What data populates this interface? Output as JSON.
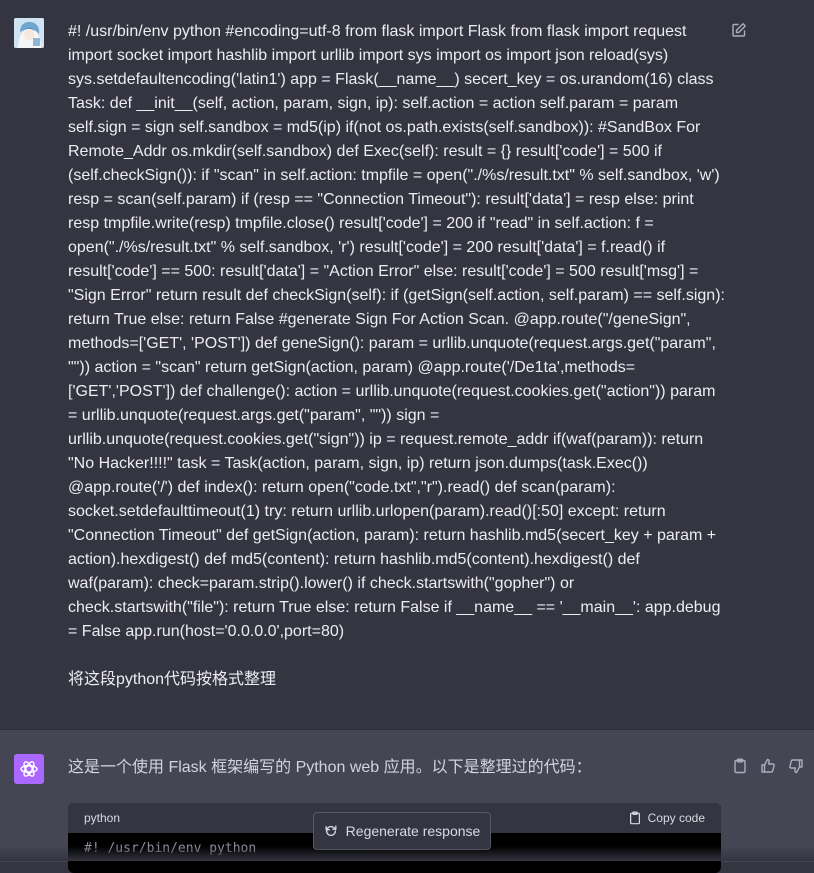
{
  "user_message": {
    "code_text": "#! /usr/bin/env python #encoding=utf-8 from flask import Flask from flask import request import socket import hashlib import urllib import sys import os import json reload(sys) sys.setdefaultencoding('latin1') app = Flask(__name__) secert_key = os.urandom(16) class Task: def __init__(self, action, param, sign, ip): self.action = action self.param = param self.sign = sign self.sandbox = md5(ip) if(not os.path.exists(self.sandbox)): #SandBox For Remote_Addr os.mkdir(self.sandbox) def Exec(self): result = {} result['code'] = 500 if (self.checkSign()): if \"scan\" in self.action: tmpfile = open(\"./%s/result.txt\" % self.sandbox, 'w') resp = scan(self.param) if (resp == \"Connection Timeout\"): result['data'] = resp else: print resp tmpfile.write(resp) tmpfile.close() result['code'] = 200 if \"read\" in self.action: f = open(\"./%s/result.txt\" % self.sandbox, 'r') result['code'] = 200 result['data'] = f.read() if result['code'] == 500: result['data'] = \"Action Error\" else: result['code'] = 500 result['msg'] = \"Sign Error\" return result def checkSign(self): if (getSign(self.action, self.param) == self.sign): return True else: return False #generate Sign For Action Scan. @app.route(\"/geneSign\", methods=['GET', 'POST']) def geneSign(): param = urllib.unquote(request.args.get(\"param\", \"\")) action = \"scan\" return getSign(action, param) @app.route('/De1ta',methods=['GET','POST']) def challenge(): action = urllib.unquote(request.cookies.get(\"action\")) param = urllib.unquote(request.args.get(\"param\", \"\")) sign = urllib.unquote(request.cookies.get(\"sign\")) ip = request.remote_addr if(waf(param)): return \"No Hacker!!!!\" task = Task(action, param, sign, ip) return json.dumps(task.Exec()) @app.route('/') def index(): return open(\"code.txt\",\"r\").read() def scan(param): socket.setdefaulttimeout(1) try: return urllib.urlopen(param).read()[:50] except: return \"Connection Timeout\" def getSign(action, param): return hashlib.md5(secert_key + param + action).hexdigest() def md5(content): return hashlib.md5(content).hexdigest() def waf(param): check=param.strip().lower() if check.startswith(\"gopher\") or check.startswith(\"file\"): return True else: return False if __name__ == '__main__': app.debug = False app.run(host='0.0.0.0',port=80)",
    "instruction": "将这段python代码按格式整理"
  },
  "assistant_message": {
    "intro": "这是一个使用 Flask 框架编写的 Python web 应用。以下是整理过的代码：",
    "code_language": "python",
    "copy_label": "Copy code",
    "code_first_line": "#! /usr/bin/env python"
  },
  "regenerate_label": "Regenerate response",
  "colors": {
    "background": "#343541",
    "assistant_row": "#444654",
    "gpt_avatar": "#ab68ff"
  },
  "icons": [
    "user-avatar-icon",
    "edit-icon",
    "chatgpt-logo-icon",
    "clipboard-icon",
    "thumbs-up-icon",
    "thumbs-down-icon",
    "regenerate-icon"
  ]
}
